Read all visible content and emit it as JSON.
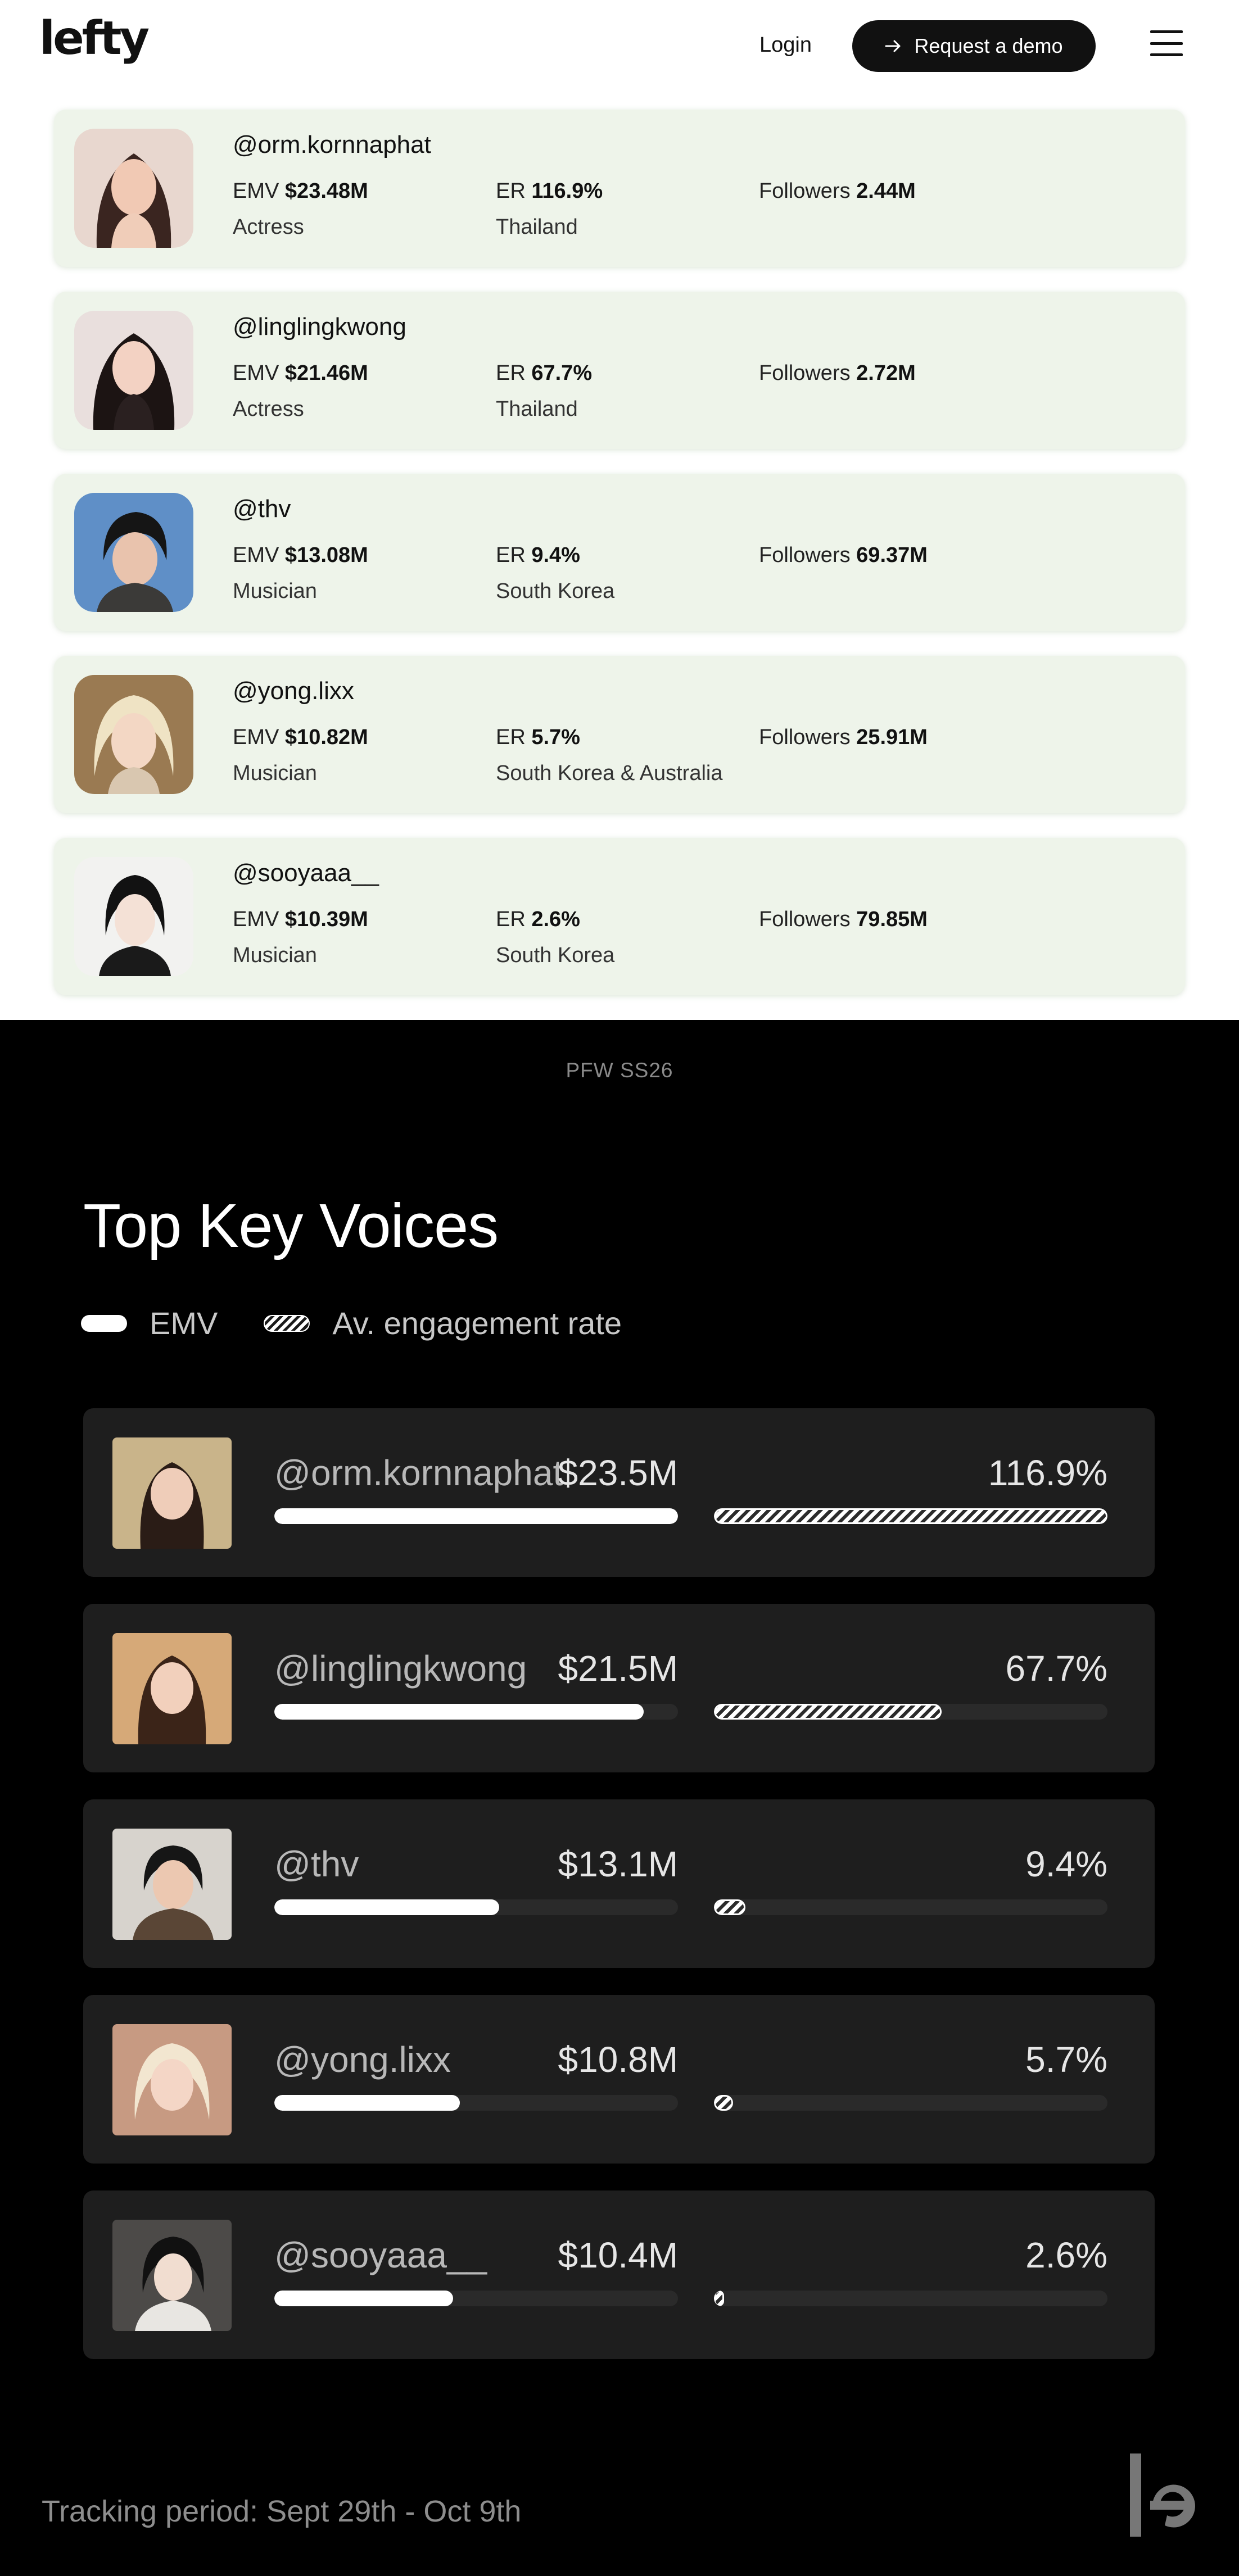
{
  "header": {
    "logo": "lefty",
    "login": "Login",
    "demo_label": "Request a demo",
    "demo_icon": "arrow-right-icon",
    "menu_icon": "hamburger-menu-icon"
  },
  "creators": [
    {
      "handle": "@orm.kornnaphat",
      "emv_label": "EMV",
      "emv": "$23.48M",
      "er_label": "ER",
      "er": "116.9%",
      "followers_label": "Followers",
      "followers": "2.44M",
      "role": "Actress",
      "country": "Thailand"
    },
    {
      "handle": "@linglingkwong",
      "emv_label": "EMV",
      "emv": "$21.46M",
      "er_label": "ER",
      "er": "67.7%",
      "followers_label": "Followers",
      "followers": "2.72M",
      "role": "Actress",
      "country": "Thailand"
    },
    {
      "handle": "@thv",
      "emv_label": "EMV",
      "emv": "$13.08M",
      "er_label": "ER",
      "er": "9.4%",
      "followers_label": "Followers",
      "followers": "69.37M",
      "role": "Musician",
      "country": "South Korea"
    },
    {
      "handle": "@yong.lixx",
      "emv_label": "EMV",
      "emv": "$10.82M",
      "er_label": "ER",
      "er": "5.7%",
      "followers_label": "Followers",
      "followers": "25.91M",
      "role": "Musician",
      "country": "South Korea & Australia"
    },
    {
      "handle": "@sooyaaa__",
      "emv_label": "EMV",
      "emv": "$10.39M",
      "er_label": "ER",
      "er": "2.6%",
      "followers_label": "Followers",
      "followers": "79.85M",
      "role": "Musician",
      "country": "South Korea"
    }
  ],
  "event_tag": "PFW SS26",
  "section_title": "Top Key Voices",
  "legend": {
    "emv": "EMV",
    "er": "Av. engagement rate"
  },
  "voices": [
    {
      "handle": "@orm.kornnaphat",
      "emv": "$23.5M",
      "er": "116.9%",
      "emv_value": 23.5,
      "er_value": 116.9
    },
    {
      "handle": "@linglingkwong",
      "emv": "$21.5M",
      "er": "67.7%",
      "emv_value": 21.5,
      "er_value": 67.7
    },
    {
      "handle": "@thv",
      "emv": "$13.1M",
      "er": "9.4%",
      "emv_value": 13.1,
      "er_value": 9.4
    },
    {
      "handle": "@yong.lixx",
      "emv": "$10.8M",
      "er": "5.7%",
      "emv_value": 10.8,
      "er_value": 5.7
    },
    {
      "handle": "@sooyaaa__",
      "emv": "$10.4M",
      "er": "2.6%",
      "emv_value": 10.4,
      "er_value": 2.6
    }
  ],
  "tracking": "Tracking period: Sept 29th - Oct 9th",
  "colors": {
    "card_bg": "#eef4ea",
    "dark_bg": "#000000",
    "voice_card": "#1e1e1e"
  }
}
